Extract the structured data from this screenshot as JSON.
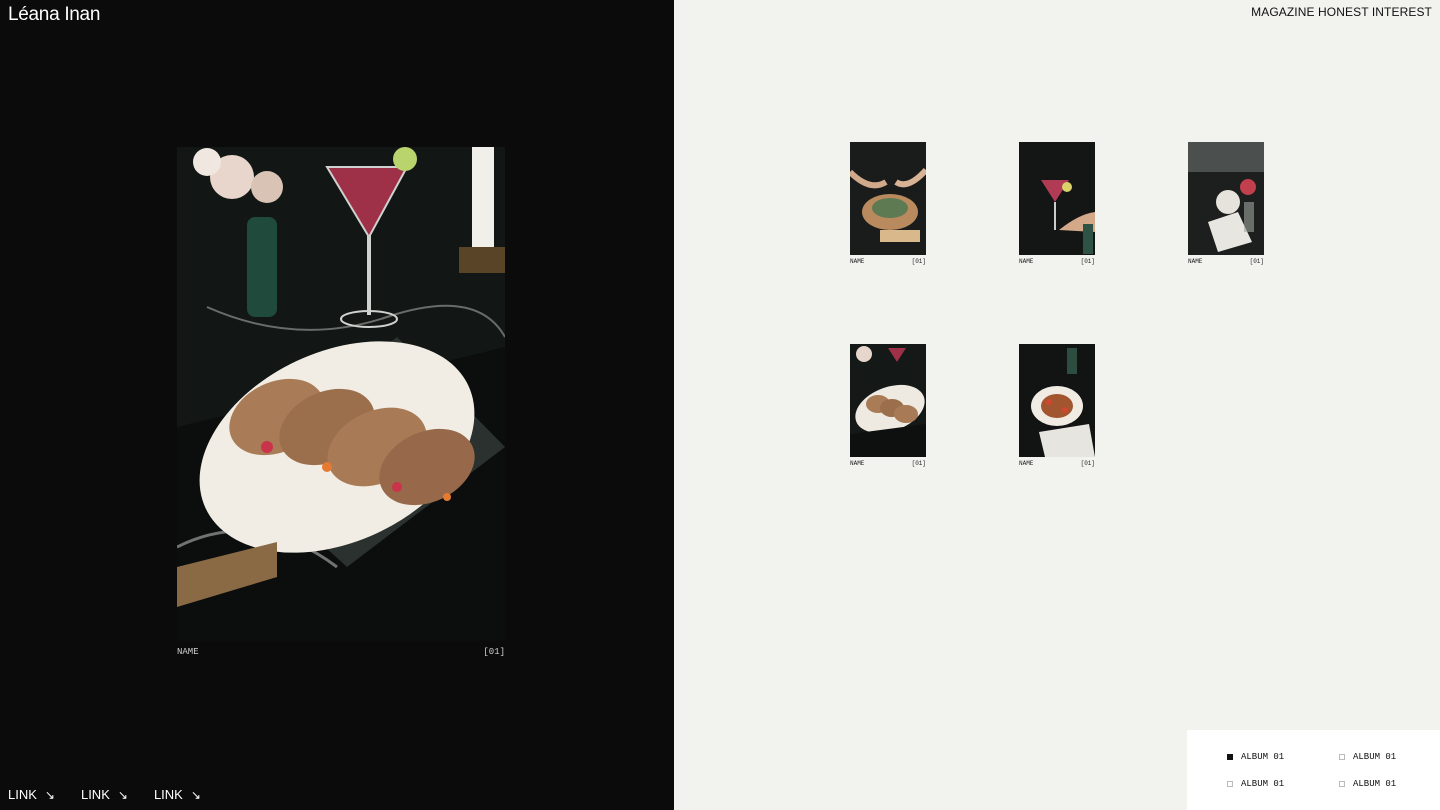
{
  "brand": "Léana Inan",
  "tagline": "MAGAZINE HONEST INTEREST",
  "hero": {
    "caption_name": "NAME",
    "caption_index": "[01]"
  },
  "footer_links": [
    {
      "label": "LINK",
      "arrow": "↘"
    },
    {
      "label": "LINK",
      "arrow": "↘"
    },
    {
      "label": "LINK",
      "arrow": "↘"
    }
  ],
  "thumbnails": [
    {
      "name": "NAME",
      "index": "[01]"
    },
    {
      "name": "NAME",
      "index": "[01]"
    },
    {
      "name": "NAME",
      "index": "[01]"
    },
    {
      "name": "NAME",
      "index": "[01]"
    },
    {
      "name": "NAME",
      "index": "[01]"
    }
  ],
  "albums": [
    {
      "label": "ALBUM 01",
      "active": true
    },
    {
      "label": "ALBUM 01",
      "active": false
    },
    {
      "label": "ALBUM 01",
      "active": false
    },
    {
      "label": "ALBUM 01",
      "active": false
    }
  ],
  "colors": {
    "left_bg": "#0b0b0b",
    "right_bg": "#f2f2ee",
    "album_panel_bg": "#ffffff"
  }
}
